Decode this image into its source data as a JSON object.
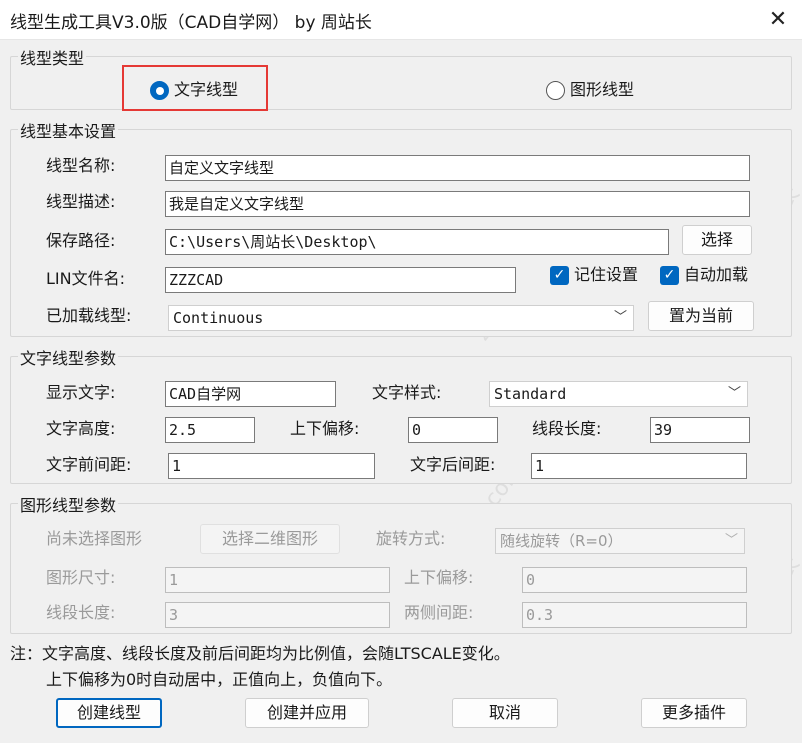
{
  "window": {
    "title": "线型生成工具V3.0版（CAD自学网） by 周站长"
  },
  "type_group": {
    "label": "线型类型",
    "text_option": "文字线型",
    "shape_option": "图形线型"
  },
  "basic_group": {
    "label": "线型基本设置",
    "name_label": "线型名称:",
    "name_value": "自定义文字线型",
    "desc_label": "线型描述:",
    "desc_value": "我是自定义文字线型",
    "path_label": "保存路径:",
    "path_value": "C:\\Users\\周站长\\Desktop\\",
    "choose_button": "选择",
    "lin_label": "LIN文件名:",
    "lin_value": "ZZZCAD",
    "remember_label": "记住设置",
    "autoload_label": "自动加载",
    "loaded_label": "已加载线型:",
    "loaded_value": "Continuous",
    "set_current_button": "置为当前"
  },
  "text_group": {
    "label": "文字线型参数",
    "display_label": "显示文字:",
    "display_value": "CAD自学网",
    "style_label": "文字样式:",
    "style_value": "Standard",
    "height_label": "文字高度:",
    "height_value": "2.5",
    "offset_label": "上下偏移:",
    "offset_value": "0",
    "segment_label": "线段长度:",
    "segment_value": "39",
    "before_label": "文字前间距:",
    "before_value": "1",
    "after_label": "文字后间距:",
    "after_value": "1"
  },
  "shape_group": {
    "label": "图形线型参数",
    "none_selected": "尚未选择图形",
    "select_2d_button": "选择二维图形",
    "rotation_label": "旋转方式:",
    "rotation_value": "随线旋转（R=0）",
    "size_label": "图形尺寸:",
    "size_value": "1",
    "offset_label": "上下偏移:",
    "offset_value": "0",
    "segment_label": "线段长度:",
    "segment_value": "3",
    "gap_label": "两侧间距:",
    "gap_value": "0.3"
  },
  "notes": {
    "line1": "注：文字高度、线段长度及前后间距均为比例值，会随LTSCALE变化。",
    "line2": "上下偏移为0时自动居中，正值向上，负值向下。"
  },
  "buttons": {
    "create": "创建线型",
    "create_apply": "创建并应用",
    "cancel": "取消",
    "more_plugins": "更多插件"
  },
  "icons": {
    "close": "close-icon",
    "checkmark": "checkmark-icon",
    "dropdown": "chevron-down-icon"
  },
  "colors": {
    "accent": "#0067c0",
    "highlight_box": "#e53935",
    "disabled_text": "#9a9a9a"
  }
}
